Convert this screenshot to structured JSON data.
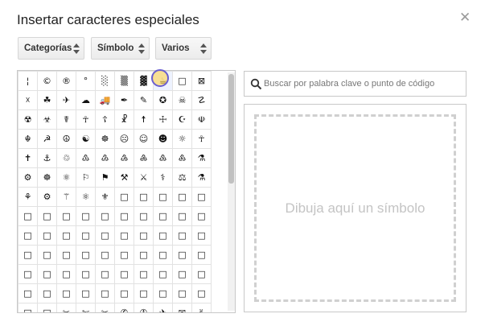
{
  "dialog": {
    "title": "Insertar caracteres especiales",
    "close_glyph": "✕"
  },
  "dropdowns": [
    {
      "label": "Categorías"
    },
    {
      "label": "Símbolo"
    },
    {
      "label": "Varios"
    }
  ],
  "grid": {
    "rows": [
      [
        "¦",
        "©",
        "®",
        "°",
        "░",
        "▒",
        "▓",
        "☕",
        "□",
        "⊠"
      ],
      [
        "☓",
        "☘",
        "✈",
        "☁",
        "🚚",
        "✒",
        "✎",
        "✪",
        "☠",
        "☡"
      ],
      [
        "☢",
        "☣",
        "☤",
        "☥",
        "☦",
        "☧",
        "☨",
        "☩",
        "☪",
        "☫"
      ],
      [
        "☬",
        "☭",
        "☮",
        "☯",
        "☸",
        "☹",
        "☺",
        "☻",
        "☼",
        "☥"
      ],
      [
        "✝",
        "⚓",
        "♲",
        "♳",
        "♴",
        "♵",
        "♶",
        "♷",
        "♸",
        "⚗"
      ],
      [
        "⚙",
        "☸",
        "⚛",
        "⚐",
        "⚑",
        "⚒",
        "⚔",
        "⚕",
        "⚖",
        "⚗"
      ],
      [
        "⚘",
        "⚙",
        "⚚",
        "⚛",
        "⚜",
        "□",
        "□",
        "□",
        "□",
        "□"
      ],
      [
        "□",
        "□",
        "□",
        "□",
        "□",
        "□",
        "□",
        "□",
        "□",
        "□"
      ],
      [
        "□",
        "□",
        "□",
        "□",
        "□",
        "□",
        "□",
        "□",
        "□",
        "□"
      ],
      [
        "□",
        "□",
        "□",
        "□",
        "□",
        "□",
        "□",
        "□",
        "□",
        "□"
      ],
      [
        "□",
        "□",
        "□",
        "□",
        "□",
        "□",
        "□",
        "□",
        "□",
        "□"
      ],
      [
        "□",
        "□",
        "□",
        "□",
        "□",
        "□",
        "□",
        "□",
        "□",
        "□"
      ],
      [
        "□",
        "□",
        "✂",
        "✄",
        "✂",
        "✆",
        "✇",
        "✈",
        "✉",
        "✌"
      ]
    ]
  },
  "search": {
    "placeholder": "Buscar por palabra clave o punto de código",
    "icon": "search-icon"
  },
  "draw": {
    "label": "Dibuja aquí un símbolo"
  },
  "colors": {
    "highlight": "#ffcd3c",
    "cursor_ring": "#6a5fd0"
  }
}
